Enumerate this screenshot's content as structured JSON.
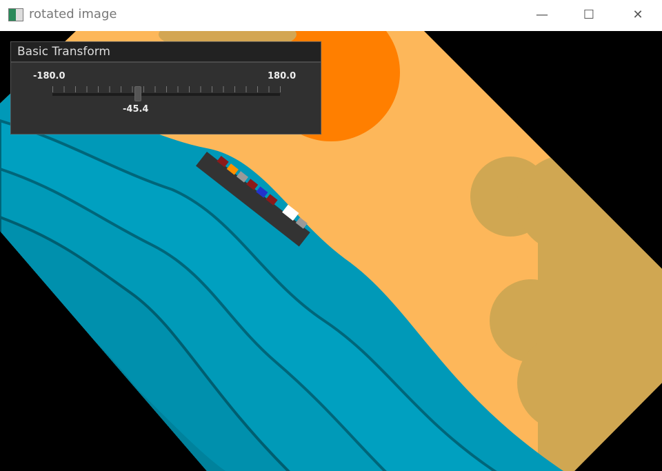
{
  "window": {
    "title": "rotated image",
    "minimize": "—",
    "maximize": "☐",
    "close": "✕"
  },
  "panel": {
    "title": "Basic Transform",
    "slider": {
      "min_label": "-180.0",
      "max_label": "180.0",
      "value_label": "-45.4",
      "min": -180,
      "max": 180,
      "value": -45.4
    }
  }
}
